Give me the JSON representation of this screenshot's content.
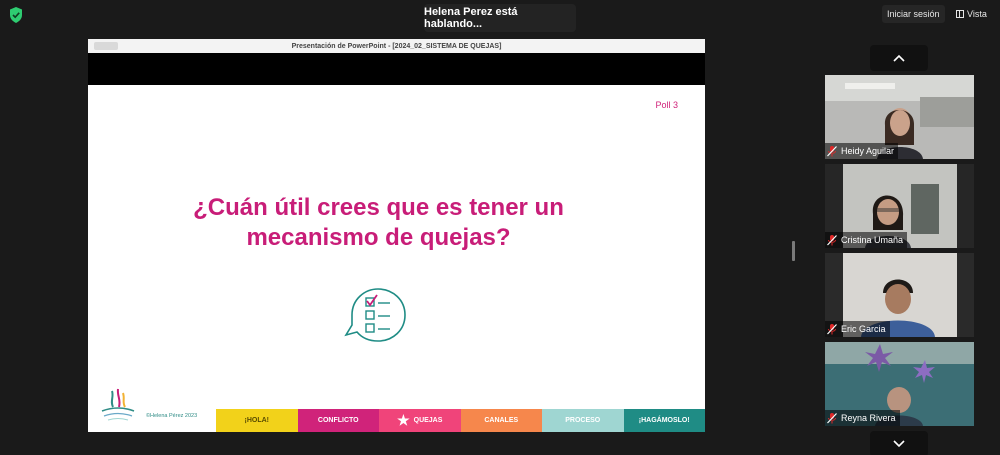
{
  "topbar": {
    "speaker_status": "Helena Perez está hablando...",
    "signin_label": "Iniciar sesión",
    "view_label": "Vista"
  },
  "share": {
    "window_title": "Presentación de PowerPoint - [2024_02_SISTEMA DE QUEJAS]",
    "slide": {
      "poll_label": "Poll 3",
      "question_line1": "¿Cuán útil crees que es tener un",
      "question_line2": "mecanismo de quejas?",
      "copyright": "©Helena Pérez 2023",
      "tabs": [
        {
          "label": "¡HOLA!",
          "color": "#f2d21a"
        },
        {
          "label": "CONFLICTO",
          "color": "#d0237a"
        },
        {
          "label": "QUEJAS",
          "color": "#f0447a"
        },
        {
          "label": "CANALES",
          "color": "#f6874c"
        },
        {
          "label": "PROCESO",
          "color": "#9fd6d2"
        },
        {
          "label": "¡HAGÁMOSLO!",
          "color": "#1f8c85"
        }
      ]
    }
  },
  "participants": [
    {
      "name": "Heidy Aguilar",
      "muted": true
    },
    {
      "name": "Cristina Umaña",
      "muted": true
    },
    {
      "name": "Eric Garcia",
      "muted": true
    },
    {
      "name": "Reyna Rivera",
      "muted": true
    }
  ],
  "icons": {
    "security": "shield-check-icon",
    "scroll_up": "chevron-up-icon",
    "scroll_down": "chevron-down-icon",
    "mic": "mic-muted-icon"
  },
  "colors": {
    "accent_magenta": "#c81d78",
    "muted_red": "#e02828",
    "shield_green": "#2ecc71"
  }
}
